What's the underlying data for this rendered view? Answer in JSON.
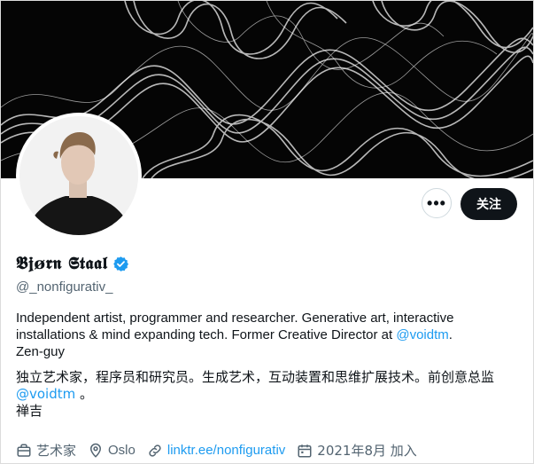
{
  "profile": {
    "display_name": "𝕭𝖏ø𝖗𝖓 𝕾𝖙𝖆𝖆𝖑",
    "handle": "@_nonfigurativ_",
    "bio_en_line1": "Independent artist, programmer and researcher. Generative art, interactive installations & mind expanding tech. Former Creative Director at ",
    "bio_en_mention": "@voidtm",
    "bio_en_after_mention": ".",
    "bio_en_line3": "Zen-guy",
    "bio_zh_line1": "独立艺术家，程序员和研究员。生成艺术，互动装置和思维扩展技术。前创意总监",
    "bio_zh_mention": "@voidtm",
    "bio_zh_after_mention": " 。",
    "bio_zh_line3": "禅吉"
  },
  "actions": {
    "more_label": "•••",
    "follow_label": "关注"
  },
  "meta": {
    "category": "艺术家",
    "location": "Oslo",
    "website": "linktr.ee/nonfigurativ",
    "joined": "2021年8月 加入"
  },
  "colors": {
    "accent": "#1d9bf0",
    "text": "#0f1419",
    "secondary": "#536471",
    "banner_bg": "#050505"
  },
  "icons": {
    "verified": "verified-badge-icon",
    "more": "more-icon",
    "category": "briefcase-icon",
    "location": "location-pin-icon",
    "website": "link-icon",
    "joined": "calendar-icon"
  }
}
